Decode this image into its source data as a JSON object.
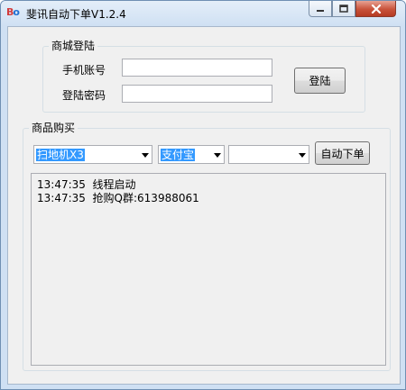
{
  "window": {
    "icon_b": "B",
    "icon_o": "o",
    "title": "斐讯自动下单V1.2.4"
  },
  "login_group": {
    "title": "商城登陆",
    "account_label": "手机账号",
    "password_label": "登陆密码",
    "account_value": "",
    "password_value": "",
    "login_button": "登陆"
  },
  "purchase_group": {
    "title": "商品购买",
    "product_select": "扫地机X3",
    "payment_select": "支付宝",
    "third_select": "",
    "auto_order_button": "自动下单"
  },
  "log": [
    {
      "time": "13:47:35",
      "message": "线程启动"
    },
    {
      "time": "13:47:35",
      "message": "抢购Q群:613988061"
    }
  ],
  "colors": {
    "selection": "#3399ff",
    "close_button": "#c8523a"
  }
}
